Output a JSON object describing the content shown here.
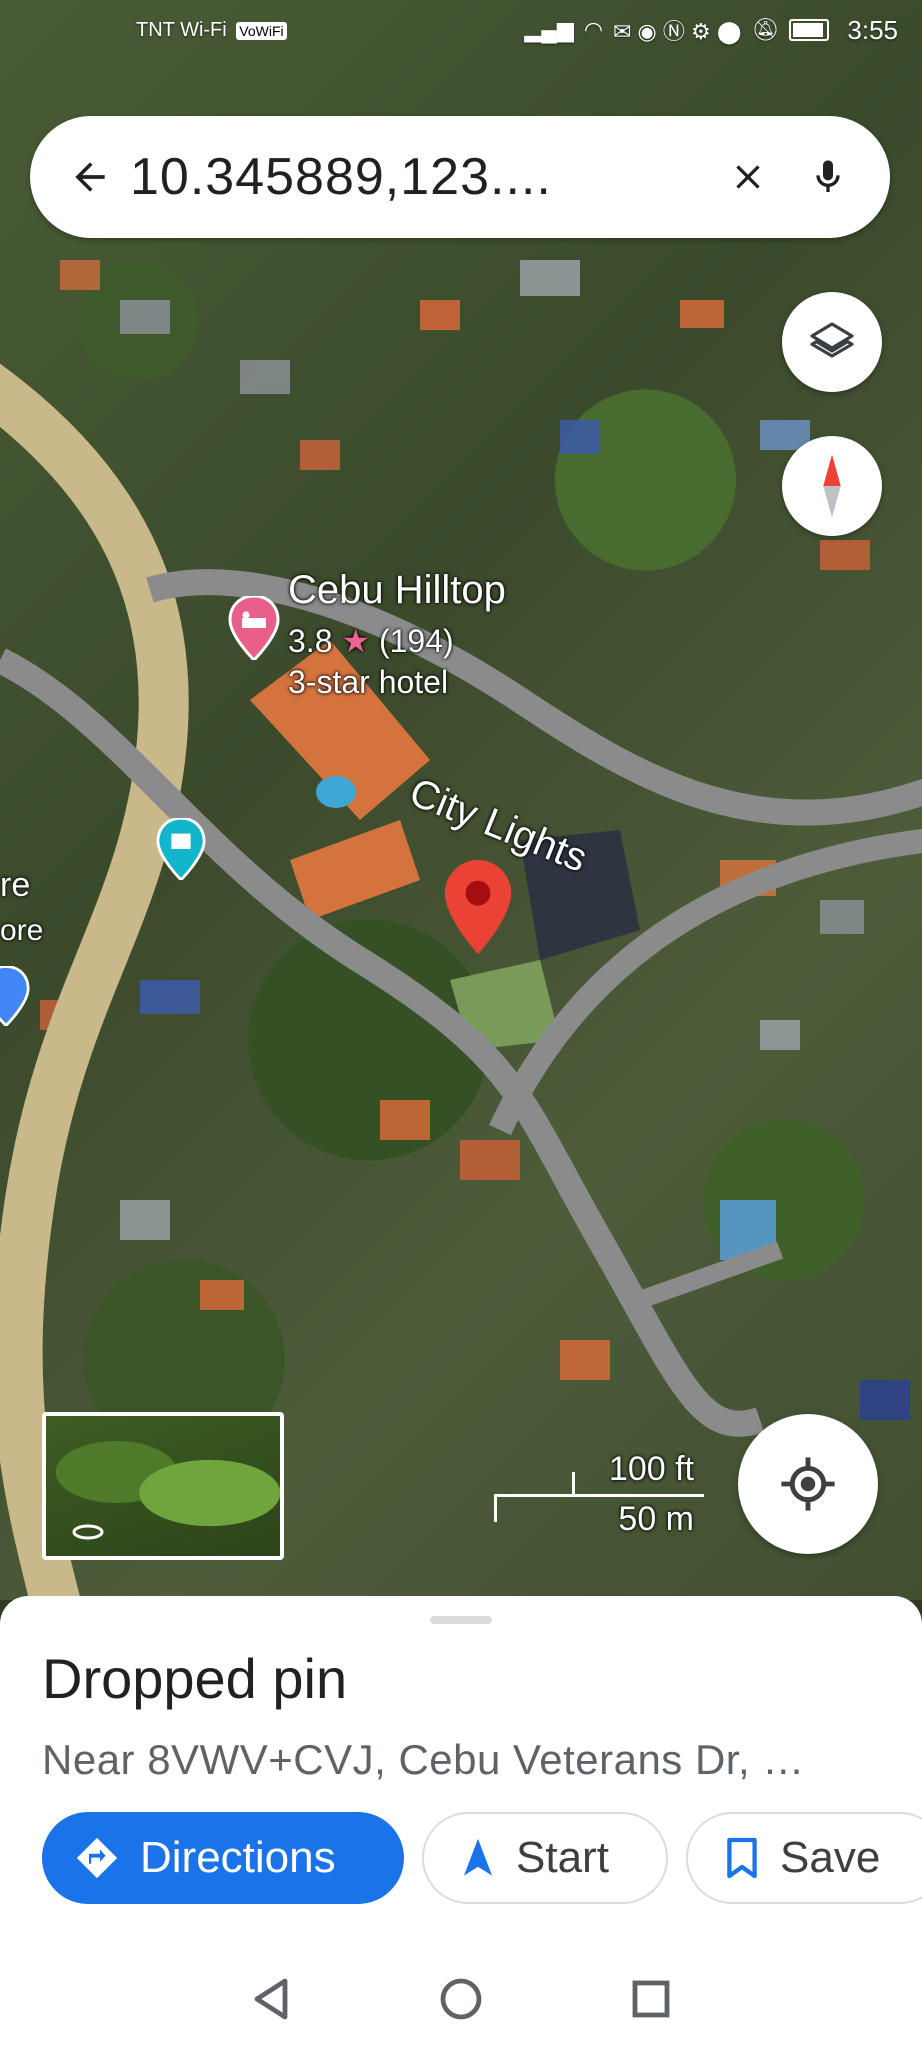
{
  "status_bar": {
    "carrier": "TNT Wi-Fi",
    "vowifi": "VoWiFi",
    "time": "3:55"
  },
  "search": {
    "query": "10.345889,123...."
  },
  "map": {
    "poi_hotel": {
      "name": "Cebu Hilltop",
      "rating": "3.8",
      "star": "★",
      "reviews": "(194)",
      "category": "3-star hotel"
    },
    "road_label": "City Lights",
    "partial_labels": [
      "re",
      "ore"
    ],
    "scale": {
      "feet": "100 ft",
      "meters": "50 m"
    }
  },
  "place": {
    "title": "Dropped pin",
    "address": "Near 8VWV+CVJ, Cebu Veterans Dr, …"
  },
  "actions": {
    "directions": "Directions",
    "start": "Start",
    "save": "Save"
  },
  "colors": {
    "accent": "#1a73e8",
    "pin": "#ea4335",
    "hotel_pin": "#e8608a",
    "attraction_pin": "#12b5cb"
  }
}
